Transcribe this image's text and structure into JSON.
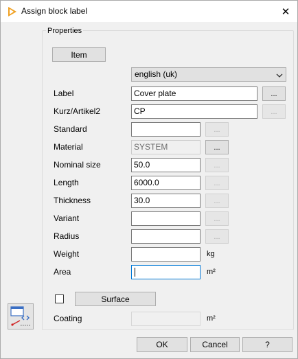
{
  "window": {
    "title": "Assign block label",
    "close": "✕"
  },
  "group": {
    "label": "Properties"
  },
  "item_button": "Item",
  "language": "english (uk)",
  "ellipsis": "...",
  "rows": [
    {
      "label": "Label",
      "value": "Cover plate"
    },
    {
      "label": "Kurz/Artikel2",
      "value": "CP"
    },
    {
      "label": "Standard",
      "value": ""
    },
    {
      "label": "Material",
      "value": "SYSTEM"
    },
    {
      "label": "Nominal size",
      "value": "50.0"
    },
    {
      "label": "Length",
      "value": "6000.0"
    },
    {
      "label": "Thickness",
      "value": "30.0"
    },
    {
      "label": "Variant",
      "value": ""
    },
    {
      "label": "Radius",
      "value": ""
    },
    {
      "label": "Weight",
      "value": "",
      "unit": "kg"
    },
    {
      "label": "Area",
      "value": "",
      "unit": "m²"
    }
  ],
  "surface_button": "Surface",
  "coating": {
    "label": "Coating",
    "value": "",
    "unit": "m²"
  },
  "footer": {
    "ok": "OK",
    "cancel": "Cancel",
    "help": "?"
  }
}
